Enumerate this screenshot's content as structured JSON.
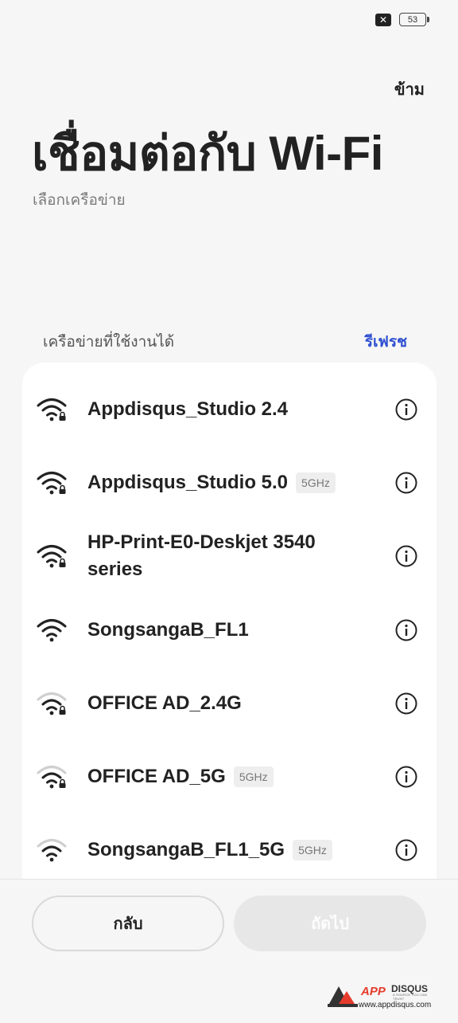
{
  "status_bar": {
    "sim_icon": "sim-off-icon",
    "battery_level": "53"
  },
  "header": {
    "skip_label": "ข้าม",
    "title": "เชื่อมต่อกับ Wi-Fi",
    "subtitle": "เลือกเครือข่าย"
  },
  "networks_section": {
    "label": "เครือข่ายที่ใช้งานได้",
    "refresh_label": "รีเฟรช"
  },
  "networks": [
    {
      "name": "Appdisqus_Studio 2.4",
      "badge": null,
      "secured": true,
      "signal": "full"
    },
    {
      "name": "Appdisqus_Studio 5.0",
      "badge": "5GHz",
      "secured": true,
      "signal": "full"
    },
    {
      "name": "HP-Print-E0-Deskjet 3540 series",
      "badge": null,
      "secured": true,
      "signal": "full"
    },
    {
      "name": "SongsangaB_FL1",
      "badge": null,
      "secured": false,
      "signal": "full"
    },
    {
      "name": "OFFICE AD_2.4G",
      "badge": null,
      "secured": true,
      "signal": "medium"
    },
    {
      "name": "OFFICE AD_5G",
      "badge": "5GHz",
      "secured": true,
      "signal": "medium"
    },
    {
      "name": "SongsangaB_FL1_5G",
      "badge": "5GHz",
      "secured": false,
      "signal": "medium"
    }
  ],
  "footer": {
    "back_label": "กลับ",
    "next_label": "ถัดไป"
  },
  "watermark": {
    "brand_app": "APP",
    "brand_disqus": "DISQUS",
    "tagline": "A SOURCE YOU CAN TRUST",
    "url": "www.appdisqus.com"
  },
  "colors": {
    "accent": "#2d4fd0",
    "background": "#f6f6f6",
    "card": "#ffffff",
    "disabled_button": "#e7e7e7"
  }
}
